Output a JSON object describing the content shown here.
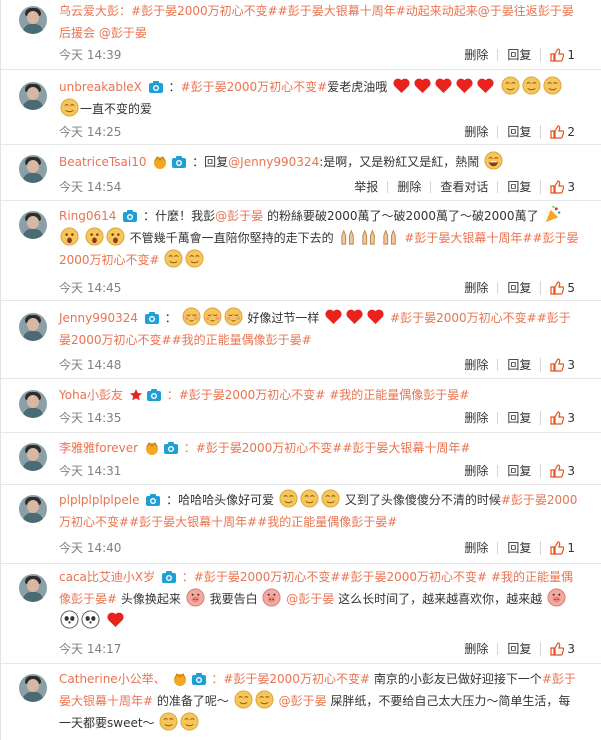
{
  "actions": {
    "delete": "删除",
    "reply": "回复",
    "report": "举报",
    "view_dialog": "查看对话"
  },
  "comments": [
    {
      "user": "乌云爱大彭",
      "text_a": "：#彭于晏2000万初心不变##彭于晏大银幕十周年#动起来动起来",
      "mention": "@于晏往返彭于晏后援会",
      "mention2": "@彭于晏",
      "time": "今天 14:39",
      "likes": "1"
    },
    {
      "user": "unbreakableX",
      "tag": "#彭于晏2000万初心不变#",
      "text_a": "爱老虎油哦",
      "text_b": "一直不变的爱",
      "time": "今天 14:25",
      "likes": "2"
    },
    {
      "user": "BeatriceTsai10",
      "text_a": "：回复",
      "mention": "@Jenny990324",
      "text_b": ":是啊，又是粉紅又是紅，熱鬧",
      "time": "今天 14:54",
      "likes": "3"
    },
    {
      "user": "Ring0614",
      "text_a": "：什麼！我彭",
      "mention": "@彭于晏",
      "text_b": "的粉絲要破2000萬了～破2000萬了～破2000萬了",
      "text_c": "不管幾千萬會一直陪你堅持的走下去的",
      "tag": "#彭于晏大银幕十周年#",
      "tag2": "#彭于晏2000万初心不变#",
      "time": "今天 14:45",
      "likes": "5"
    },
    {
      "user": "Jenny990324",
      "text_a": "：",
      "text_b": "好像过节一样",
      "tag": "#彭于晏2000万初心不变##彭于晏2000万初心不变#",
      "tag2": "#我的正能量偶像彭于晏#",
      "time": "今天 14:48",
      "likes": "3"
    },
    {
      "user": "Yoha小彭友",
      "tag": "：#彭于晏2000万初心不变#",
      "tag2": "#我的正能量偶像彭于晏#",
      "time": "今天 14:35",
      "likes": "3"
    },
    {
      "user": "李雅雅forever",
      "tag": "：#彭于晏2000万初心不变##彭于晏大银幕十周年#",
      "time": "今天 14:31",
      "likes": "3"
    },
    {
      "user": "plplplplplpele",
      "text_a": "：哈哈哈头像好可爱",
      "text_b": "又到了头像傻傻分不清的时候",
      "tag": "#彭于晏2000万初心不变#",
      "tag2": "#彭于晏大银幕十周年#",
      "tag3": "#我的正能量偶像彭于晏#",
      "time": "今天 14:40",
      "likes": "1"
    },
    {
      "user": "caca比艾迪小X岁",
      "tag": "：#彭于晏2000万初心不变##彭于晏2000万初心不变#",
      "tag2": "#我的正能量偶像彭于晏#",
      "text_a": "头像换起来",
      "text_b": "我要告白",
      "mention": "@彭于晏",
      "text_c": "这么长时间了，越来越喜欢你，越来越",
      "time": "今天 14:17",
      "likes": "3"
    },
    {
      "user": "Catherine小公举、",
      "tag": "：#彭于晏2000万初心不变#",
      "text_a": "南京的小彭友已做好迎接下一个",
      "tag2": "#彭于晏大银幕十周年#",
      "text_b": "的准备了呢～",
      "mention": "@彭于晏",
      "text_c": "屎胖纸，不要给自己太大压力～简单生活，每一天都要sweet～"
    }
  ],
  "icons": {
    "emoji_smile": "smile-emoji-icon",
    "heart": "heart-emoji-icon",
    "like": "thumb-up-icon",
    "camera_badge": "camera-badge-icon",
    "vip_badge": "member-badge-icon"
  },
  "colors": {
    "accent": "#eb7350",
    "link_blue": "#3b7bbd",
    "time_gray": "#808080",
    "heart_red": "#e8221c",
    "emoji_yellow": "#f7c65a"
  }
}
